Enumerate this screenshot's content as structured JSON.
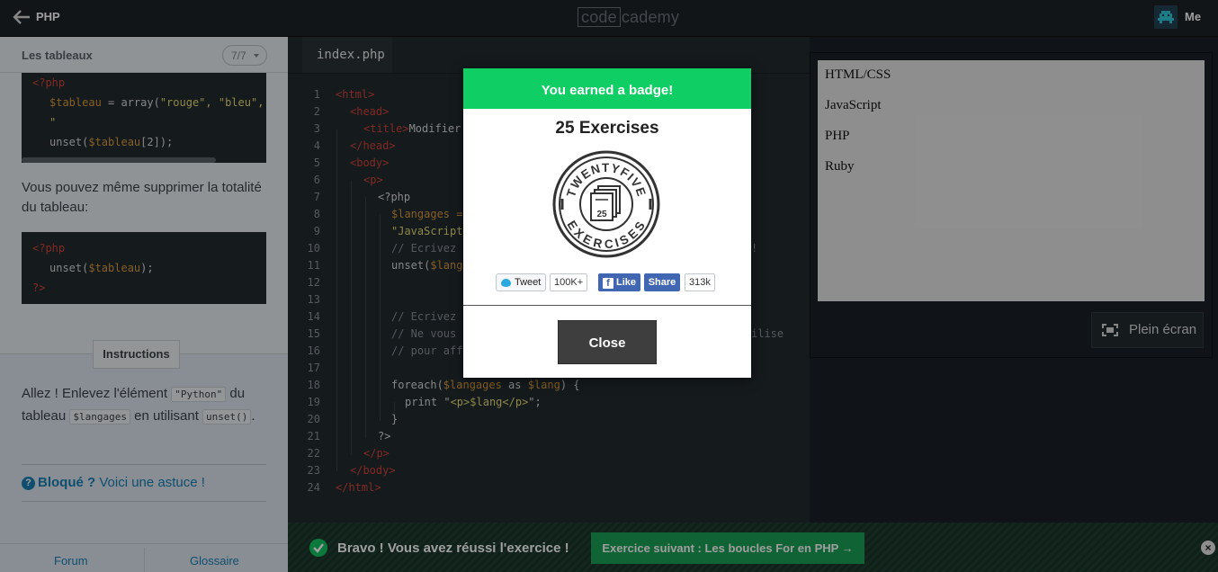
{
  "topbar": {
    "course": "PHP",
    "logo_a": "code",
    "logo_b": "cademy",
    "user": "Me"
  },
  "lesson": {
    "title": "Les tableaux",
    "pager": "7/7",
    "code1": {
      "open": "<?php",
      "line_var": "$tableau",
      "line_rest": " = array(",
      "line_strs": "\"rouge\", \"bleu\", \"",
      "line2_a": "unset(",
      "line2_var": "$tableau",
      "line2_b": "[2]);",
      "close": "?>"
    },
    "paragraph": "Vous pouvez même supprimer la totalité du tableau:",
    "code2": {
      "open": "<?php",
      "l_a": "unset(",
      "l_var": "$tableau",
      "l_b": ");",
      "close": "?>"
    },
    "instructions_tab": "Instructions",
    "instr": {
      "t1": "Allez ! Enlevez l'élément ",
      "c1": "\"Python\"",
      "t2": " du tableau ",
      "c2": "$langages",
      "t3": " en utilisant ",
      "c3": "unset()",
      "t4": "."
    },
    "hint": {
      "icon": "?",
      "bold": "Bloqué ?",
      "text": " Voici une astuce !"
    },
    "footer": {
      "forum": "Forum",
      "glossary": "Glossaire"
    }
  },
  "editor": {
    "tab": "index.php",
    "line_numbers": [
      "1",
      "2",
      "3",
      "4",
      "5",
      "6",
      "7",
      "8",
      "9",
      "10",
      "11",
      "12",
      "13",
      "14",
      "15",
      "16",
      "17",
      "18",
      "19",
      "20",
      "21",
      "22",
      "23",
      "24"
    ],
    "lines": {
      "l1": "<html>",
      "l2": "<head>",
      "l3a": "<title>",
      "l3b": "Modifier",
      "l4": "</head>",
      "l5": "<body>",
      "l6": "<p>",
      "l7": "<?php",
      "l8": "$langages =",
      "l9": "\"JavaScript",
      "l10": "// Ecrivez",
      "l10b": "!",
      "l11a": "unset(",
      "l11b": "$lang",
      "l14": "// Ecrivez",
      "l15": "// Ne vous",
      "l15b": "ilise",
      "l16": "// pour aff",
      "l18a": "foreach(",
      "l18b": "$langages",
      "l18c": " as ",
      "l18d": "$lang",
      "l18e": ") {",
      "l19a": "print \"",
      "l19b": "<p>",
      "l19c": "$lang",
      "l19d": "</p>",
      "l19e": "\";",
      "l20": "}",
      "l21": "?>",
      "l22": "</p>",
      "l23": "</body>",
      "l24": "</html>"
    }
  },
  "preview": {
    "items": [
      "HTML/CSS",
      "JavaScript",
      "PHP",
      "Ruby"
    ],
    "fullscreen": "Plein écran"
  },
  "bottom": {
    "message": "Bravo ! Vous avez réussi l'exercice !",
    "next": "Exercice suivant : Les boucles For en PHP →",
    "dismiss": "×"
  },
  "modal": {
    "header": "You earned a badge!",
    "badge_title": "25 Exercises",
    "badge_top": "TWENTYFIVE",
    "badge_bottom": "EXERCISES",
    "badge_number": "25",
    "tweet": "Tweet",
    "tweet_count": "100K+",
    "like": "Like",
    "share": "Share",
    "share_count": "313k",
    "close": "Close"
  },
  "colors": {
    "accent_green": "#0fce63",
    "link_blue": "#1a7fb4",
    "next_green": "#1aa055",
    "facebook": "#4267b2"
  }
}
